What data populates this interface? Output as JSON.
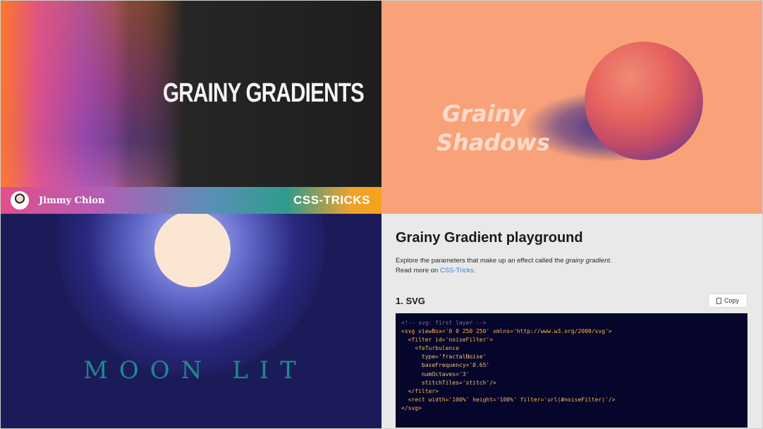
{
  "panels": {
    "grainy_gradients": {
      "title": "GRAINY GRADIENTS",
      "author": "Jimmy Chion",
      "brand": "CSS-TRICKS"
    },
    "grainy_shadows": {
      "line1": "Grainy",
      "line2": "Shadows"
    },
    "moon_lit": {
      "label": "MOON LIT"
    },
    "playground": {
      "heading": "Grainy Gradient playground",
      "desc_line1_prefix": "Explore the parameters that make up an effect called the ",
      "desc_line1_emph": "grainy gradient",
      "desc_line1_suffix": ".",
      "desc_line2_prefix": "Read more on ",
      "desc_link": "CSS-Tricks",
      "desc_line2_suffix": ".",
      "section_title": "1. SVG",
      "copy_label": "Copy",
      "code_lines": [
        "<!-- svg: first layer -->",
        "<svg viewBox='0 0 250 250' xmlns='http://www.w3.org/2000/svg'>",
        "  <filter id='noiseFilter'>",
        "    <feTurbulence",
        "      type='fractalNoise'",
        "      baseFrequency='0.65'",
        "      numOctaves='3'",
        "      stitchTiles='stitch'/>",
        "  </filter>",
        "",
        "  <rect width='100%' height='100%' filter='url(#noiseFilter)'/>",
        "</svg>"
      ]
    }
  },
  "colors": {
    "accent_link": "#2f7fd4",
    "shadows_bg": "#f9a27a",
    "moon_bg": "#1c1b5a",
    "moon_text": "#1e8b8a",
    "code_bg": "#06052b"
  }
}
